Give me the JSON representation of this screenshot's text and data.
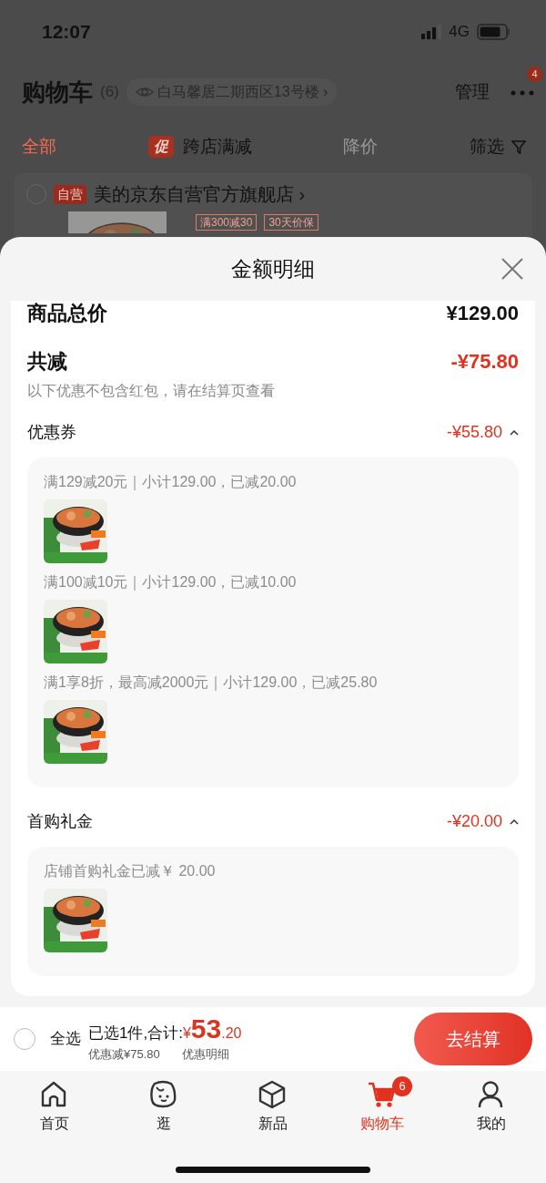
{
  "status_bar": {
    "time": "12:07",
    "network": "4G"
  },
  "header": {
    "title": "购物车",
    "count": "(6)",
    "address": "白马馨居二期西区13号楼",
    "address_chevron": "›",
    "manage": "管理",
    "more_badge": "4"
  },
  "filters": [
    {
      "label": "全部",
      "selected": true,
      "disabled": false
    },
    {
      "label": "跨店满减",
      "tag": "促",
      "selected": false,
      "disabled": false
    },
    {
      "label": "降价",
      "selected": false,
      "disabled": true
    }
  ],
  "filter_button": "筛选",
  "store": {
    "checked": false,
    "tag": "自营",
    "name": "美的京东自营官方旗舰店",
    "chevron": "›",
    "product_tags": [
      "满300减30",
      "30天价保"
    ]
  },
  "sheet": {
    "title": "金额明细",
    "total": {
      "label": "商品总价",
      "value": "¥129.00"
    },
    "reduction": {
      "label": "共减",
      "value": "-¥75.80",
      "note": "以下优惠不包含红包，请在结算页查看"
    },
    "sections": [
      {
        "title": "优惠券",
        "amount": "-¥55.80",
        "expanded": true,
        "items": [
          {
            "text": "满129减20元｜小计129.00，已减20.00",
            "kind": "picture"
          },
          {
            "text": "满100减10元｜小计129.00，已减10.00",
            "kind": "picture"
          },
          {
            "text": "满1享8折，最高减2000元｜小计129.00，已减25.80",
            "kind": "picture"
          }
        ]
      },
      {
        "title": "首购礼金",
        "amount": "-¥20.00",
        "expanded": true,
        "items": [
          {
            "text": "店铺首购礼金已减￥ 20.00",
            "kind": "picture"
          }
        ]
      }
    ]
  },
  "bottom_bar": {
    "select_all": {
      "label": "全选",
      "checked": false
    },
    "summary": "已选1件,合计:",
    "currency": "¥",
    "price_int": "53",
    "price_dec": ".20",
    "discount": "优惠减¥75.80",
    "detail_link": "优惠明细",
    "checkout": "去结算"
  },
  "tabs": [
    {
      "label": "首页",
      "selected": false
    },
    {
      "label": "逛",
      "selected": false
    },
    {
      "label": "新品",
      "selected": false
    },
    {
      "label": "购物车",
      "selected": true,
      "badge": "6"
    },
    {
      "label": "我的",
      "selected": false
    }
  ]
}
